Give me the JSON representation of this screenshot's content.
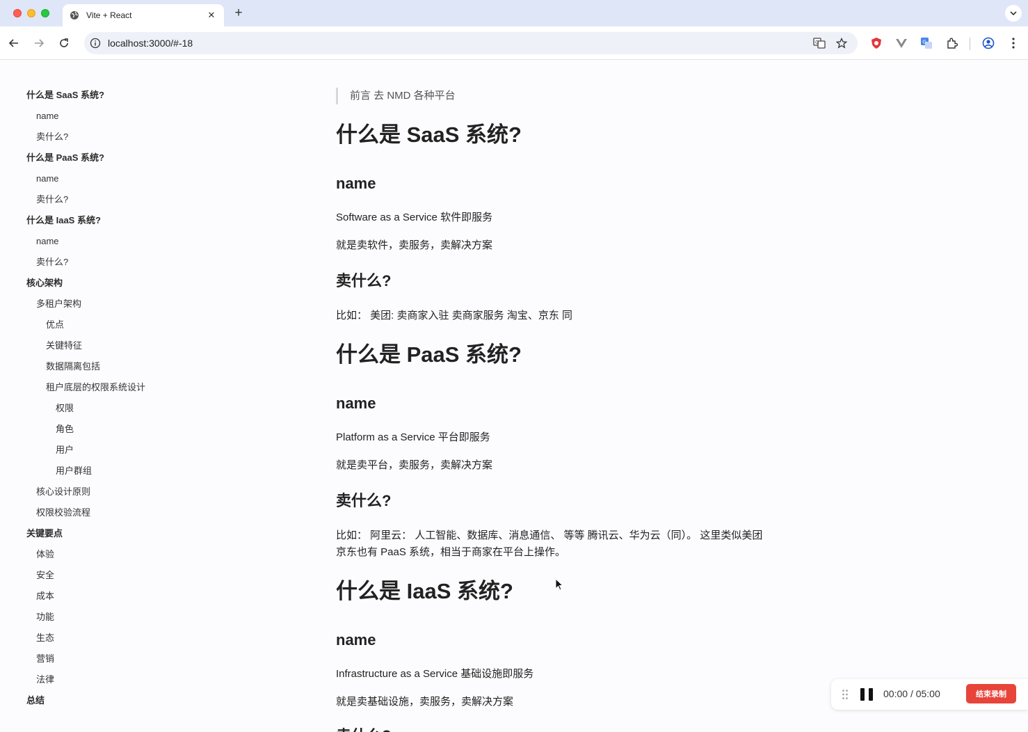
{
  "browser": {
    "tab_title": "Vite + React",
    "url": "localhost:3000/#-18"
  },
  "blockquote": "前言 去 NMD 各种平台",
  "sidebar": {
    "items": [
      {
        "label": "什么是 SaaS 系统?",
        "level": 1
      },
      {
        "label": "name",
        "level": 2
      },
      {
        "label": "卖什么?",
        "level": 2
      },
      {
        "label": "什么是 PaaS 系统?",
        "level": 1
      },
      {
        "label": "name",
        "level": 2
      },
      {
        "label": "卖什么?",
        "level": 2
      },
      {
        "label": "什么是 IaaS 系统?",
        "level": 1
      },
      {
        "label": "name",
        "level": 2
      },
      {
        "label": "卖什么?",
        "level": 2
      },
      {
        "label": "核心架构",
        "level": 1
      },
      {
        "label": "多租户架构",
        "level": 2
      },
      {
        "label": "优点",
        "level": 3
      },
      {
        "label": "关键特征",
        "level": 3
      },
      {
        "label": "数据隔离包括",
        "level": 3
      },
      {
        "label": "租户底层的权限系统设计",
        "level": 3
      },
      {
        "label": "权限",
        "level": 4
      },
      {
        "label": "角色",
        "level": 4
      },
      {
        "label": "用户",
        "level": 4
      },
      {
        "label": "用户群组",
        "level": 4
      },
      {
        "label": "核心设计原则",
        "level": 2
      },
      {
        "label": "权限校验流程",
        "level": 2
      },
      {
        "label": "关键要点",
        "level": 1
      },
      {
        "label": "体验",
        "level": 2
      },
      {
        "label": "安全",
        "level": 2
      },
      {
        "label": "成本",
        "level": 2
      },
      {
        "label": "功能",
        "level": 2
      },
      {
        "label": "生态",
        "level": 2
      },
      {
        "label": "营销",
        "level": 2
      },
      {
        "label": "法律",
        "level": 2
      },
      {
        "label": "总结",
        "level": 1
      }
    ]
  },
  "content": {
    "saas": {
      "title": "什么是 SaaS 系统?",
      "name_heading": "name",
      "name_p1": "Software as a Service 软件即服务",
      "name_p2": "就是卖软件，卖服务，卖解决方案",
      "sell_heading": "卖什么?",
      "sell_p1": "比如： 美团: 卖商家入驻 卖商家服务 淘宝、京东 同"
    },
    "paas": {
      "title": "什么是 PaaS 系统?",
      "name_heading": "name",
      "name_p1": "Platform as a Service 平台即服务",
      "name_p2": "就是卖平台，卖服务，卖解决方案",
      "sell_heading": "卖什么?",
      "sell_p1": "比如： 阿里云： 人工智能、数据库、消息通信、 等等 腾讯云、华为云（同）。 这里类似美团",
      "sell_p2": "京东也有 PaaS 系统，相当于商家在平台上操作。"
    },
    "iaas": {
      "title": "什么是 IaaS 系统?",
      "name_heading": "name",
      "name_p1": "Infrastructure as a Service 基础设施即服务",
      "name_p2": "就是卖基础设施，卖服务，卖解决方案",
      "sell_heading": "卖什么?"
    }
  },
  "recorder": {
    "elapsed": "00:00",
    "separator": "/",
    "total": "05:00",
    "stop_label": "结束录制"
  },
  "colors": {
    "accent_record": "#e8443a",
    "tabstrip": "#dfe6f7"
  }
}
